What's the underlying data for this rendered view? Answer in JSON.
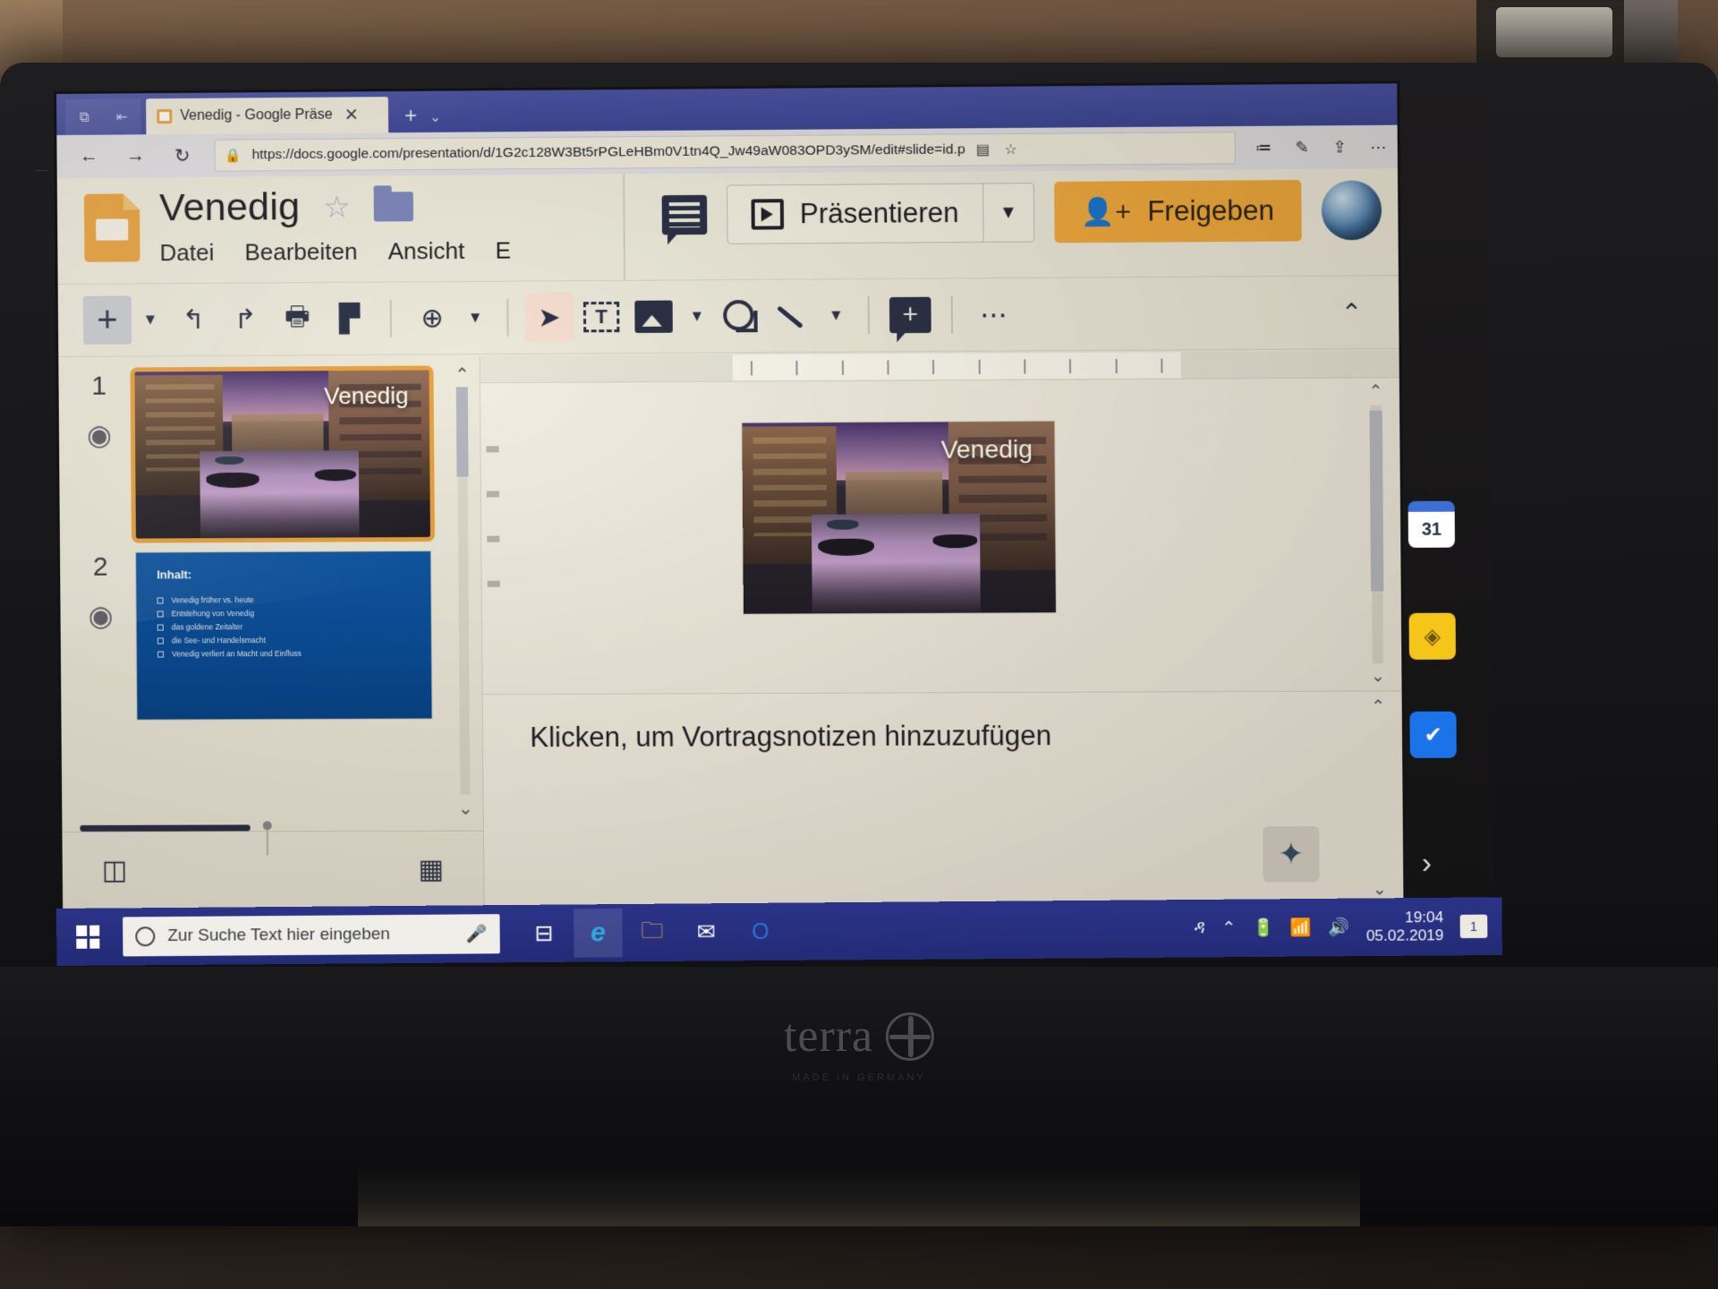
{
  "browser": {
    "tab": {
      "title": "Venedig - Google Präse",
      "close_label": "✕",
      "favicon_name": "slides-favicon"
    },
    "new_tab_label": "+",
    "tab_list_caret": "⌄",
    "sys_buttons": [
      "⧉",
      "⇤"
    ],
    "nav": {
      "back": "←",
      "forward": "→",
      "reload": "↻"
    },
    "omnibox": {
      "lock": "🔒",
      "url": "https://docs.google.com/presentation/d/1G2c128W3Bt5rPGLeHBm0V1tn4Q_Jw49aW083OPD3ySM/edit#slide=id.p",
      "reading_view": "▤",
      "favorite": "☆"
    },
    "extensions": [
      "≔",
      "✎",
      "⇪",
      "⋯"
    ]
  },
  "slides_app": {
    "doc_title": "Venedig",
    "star_icon": "☆",
    "folder_icon_name": "move-to-folder",
    "menus": [
      "Datei",
      "Bearbeiten",
      "Ansicht",
      "E"
    ],
    "comment_history_icon": "comment-history",
    "present": {
      "label": "Präsentieren",
      "caret": "▼"
    },
    "share": {
      "label": "Freigeben",
      "icon": "person-add"
    },
    "avatar_name": "account-avatar"
  },
  "toolbar": {
    "items": [
      {
        "name": "new-slide",
        "glyph": "+"
      },
      {
        "name": "new-slide-caret",
        "glyph": "▼"
      },
      {
        "name": "undo",
        "glyph": "↰"
      },
      {
        "name": "redo",
        "glyph": "↱"
      },
      {
        "name": "print",
        "glyph": "🖶"
      },
      {
        "name": "paint-format",
        "glyph": "▛"
      },
      {
        "name": "zoom",
        "glyph": "⊕"
      },
      {
        "name": "zoom-caret",
        "glyph": "▼"
      },
      {
        "name": "select",
        "glyph": "➤"
      },
      {
        "name": "text-box",
        "glyph": "T"
      },
      {
        "name": "insert-image",
        "glyph": "▣"
      },
      {
        "name": "image-caret",
        "glyph": "▼"
      },
      {
        "name": "shape",
        "glyph": "⬭"
      },
      {
        "name": "line",
        "glyph": "╲"
      },
      {
        "name": "line-caret",
        "glyph": "▼"
      },
      {
        "name": "add-comment",
        "glyph": "+"
      },
      {
        "name": "more-options",
        "glyph": "⋯"
      }
    ],
    "collapse_caret": "⌃"
  },
  "filmstrip": {
    "slides": [
      {
        "number": "1",
        "selected": true,
        "title": "Venedig",
        "type": "image-title"
      },
      {
        "number": "2",
        "selected": false,
        "title": "Inhalt:",
        "type": "bullets",
        "bullets": [
          "Venedig früher vs. heute",
          "Entstehung von Venedig",
          "das goldene Zeitalter",
          "die See- und Handelsmacht",
          "Venedig verliert an Macht und Einfluss"
        ]
      }
    ],
    "footer": {
      "layout_icon": "layout-view",
      "grid_icon": "grid-view"
    },
    "scroll": {
      "up": "⌃",
      "down": "⌄"
    }
  },
  "editor": {
    "current_slide_title": "Venedig",
    "notes_placeholder": "Klicken, um Vortragsnotizen hinzuzufügen",
    "explore_icon": "explore-sparkle",
    "scroll": {
      "up": "⌃",
      "down": "⌄"
    }
  },
  "windows_rail": {
    "items": [
      {
        "name": "google-calendar",
        "label": "31"
      },
      {
        "name": "google-keep",
        "label": "◈"
      },
      {
        "name": "google-tasks",
        "label": "✔"
      }
    ],
    "expand_arrow": "›"
  },
  "taskbar": {
    "search_placeholder": "Zur Suche Text hier eingeben",
    "mic_icon": "🎤",
    "task_view_icon": "⊟",
    "apps": [
      {
        "name": "microsoft-edge",
        "glyph": "e"
      },
      {
        "name": "file-explorer",
        "glyph": "🗀"
      },
      {
        "name": "mail",
        "glyph": "✉"
      },
      {
        "name": "outlook",
        "glyph": "O"
      }
    ],
    "tray": {
      "people": "ዳ",
      "chevron": "⌃",
      "battery": "🔋",
      "network": "📶",
      "volume": "🔊",
      "time": "19:04",
      "date": "05.02.2019",
      "notifications": "1"
    }
  },
  "laptop": {
    "brand": "terra",
    "brand_sub": "MADE IN GERMANY"
  }
}
